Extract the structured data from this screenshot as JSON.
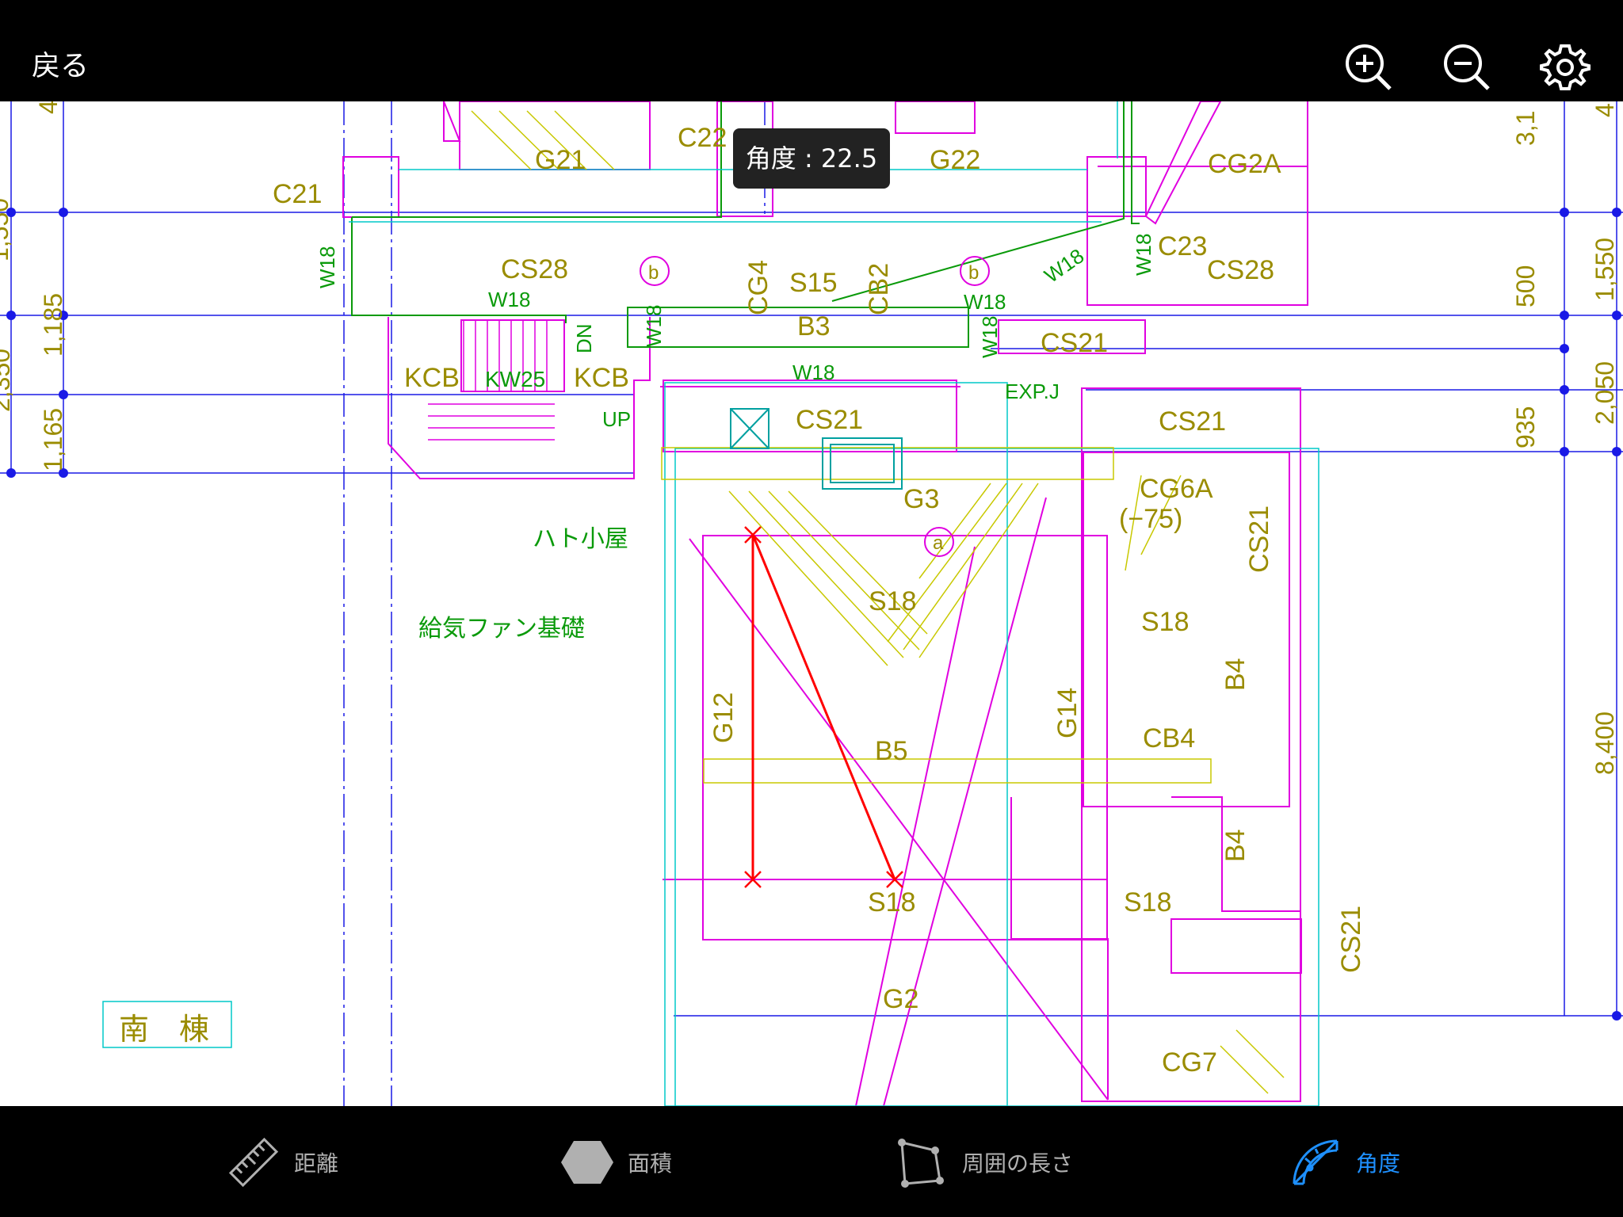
{
  "topbar": {
    "back_label": "戻る",
    "icons": [
      "zoom-in-icon",
      "zoom-out-icon",
      "gear-icon"
    ]
  },
  "measurement": {
    "tooltip": "角度 : 22.5"
  },
  "drawing": {
    "member_labels": [
      "C21",
      "G21",
      "C22",
      "G22",
      "CG2A",
      "C23",
      "CS28",
      "CS28",
      "S15",
      "CG4",
      "CB2",
      "B3",
      "W18",
      "W18",
      "W18",
      "W18",
      "W18",
      "W18",
      "W18",
      "W18",
      "KCB",
      "KW25",
      "KCB",
      "DN",
      "UP",
      "CS21",
      "CS21",
      "EXP.J",
      "CS21",
      "G3",
      "CG6A",
      "(−75)",
      "CS21",
      "S18",
      "S18",
      "G12",
      "G14",
      "CB4",
      "B4",
      "B5",
      "S18",
      "S18",
      "B4",
      "CS21",
      "G2",
      "CG7"
    ],
    "annotations": [
      "ハト小屋",
      "給気ファン基礎"
    ],
    "grid_markers": [
      "b",
      "b",
      "a"
    ],
    "building_label": "南　棟",
    "dimensions_left": [
      "4",
      "1,550",
      "1,185",
      "2,350",
      "1,165"
    ],
    "dimensions_right": [
      "3,1",
      "4",
      "500",
      "1,550",
      "2,050",
      "935",
      "8,400"
    ]
  },
  "tabs": [
    {
      "label": "距離",
      "icon": "ruler-icon",
      "active": false
    },
    {
      "label": "面積",
      "icon": "hexagon-icon",
      "active": false
    },
    {
      "label": "周囲の長さ",
      "icon": "polygon-icon",
      "active": false
    },
    {
      "label": "角度",
      "icon": "protractor-icon",
      "active": true
    }
  ],
  "colors": {
    "accent": "#1e90ff",
    "measure_line": "#ff0000",
    "member_text": "#9a8c00",
    "wall_text": "#0a9a0a",
    "grid_blue": "#1a1ae6",
    "magenta": "#e000e0",
    "cyan": "#00c8c8"
  }
}
